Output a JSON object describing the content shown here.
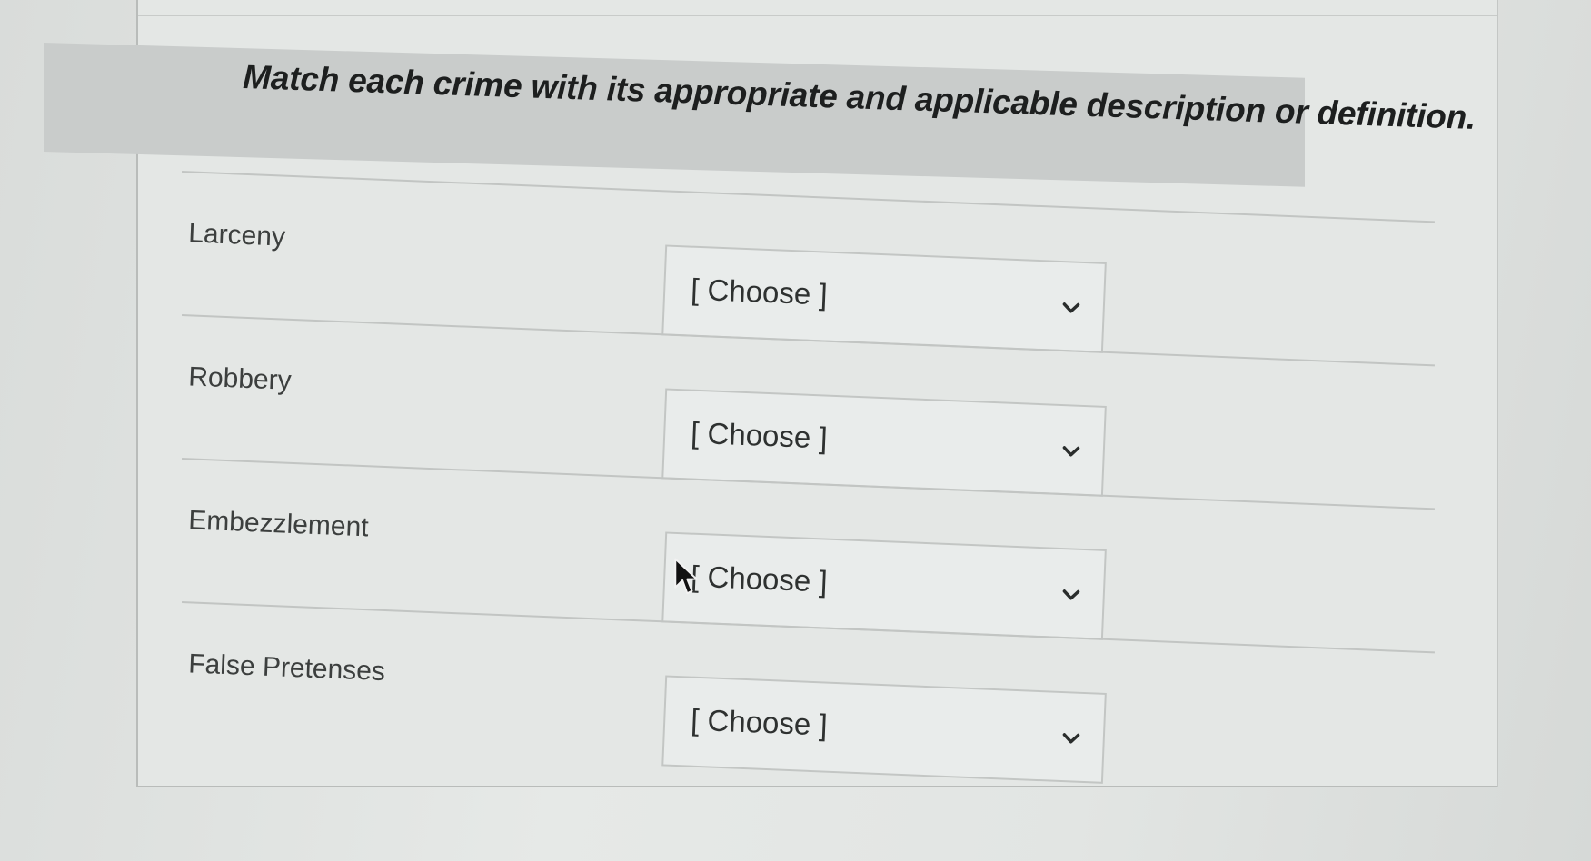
{
  "question": {
    "prompt": "Match each crime with its appropriate and applicable description or definition."
  },
  "items": [
    {
      "term": "Larceny",
      "selected": "[ Choose ]"
    },
    {
      "term": "Robbery",
      "selected": "[ Choose ]"
    },
    {
      "term": "Embezzlement",
      "selected": "[ Choose ]"
    },
    {
      "term": "False Pretenses",
      "selected": "[ Choose ]"
    }
  ],
  "icons": {
    "dropdown": "chevron-down-icon",
    "pointer": "mouse-cursor-icon"
  },
  "colors": {
    "header_bg": "#c9cccb",
    "text": "#1d1f1f",
    "border": "#c3c6c4"
  }
}
